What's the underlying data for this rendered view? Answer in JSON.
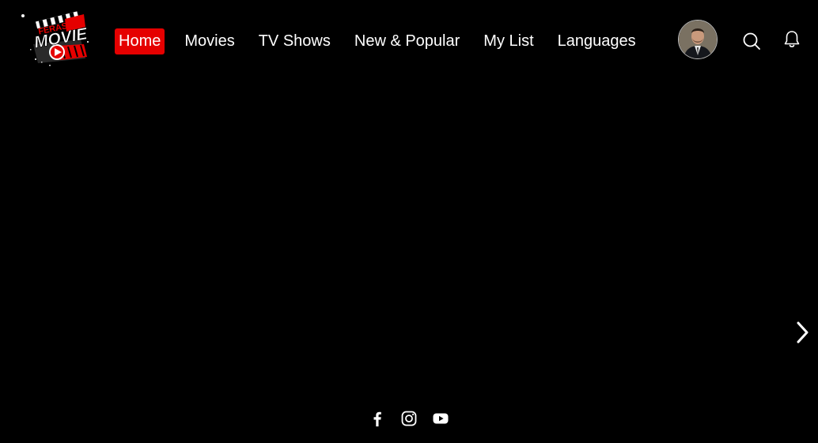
{
  "brand": {
    "logo_top_text": "FERAS",
    "logo_main_text": "MOVIE",
    "accent_color": "#e50000"
  },
  "nav": {
    "items": [
      {
        "label": "Home",
        "active": true
      },
      {
        "label": "Movies",
        "active": false
      },
      {
        "label": "TV Shows",
        "active": false
      },
      {
        "label": "New & Popular",
        "active": false
      },
      {
        "label": "My List",
        "active": false
      },
      {
        "label": "Languages",
        "active": false
      }
    ]
  },
  "header_actions": {
    "avatar_icon": "user-avatar",
    "search_icon": "search-icon",
    "notifications_icon": "bell-icon"
  },
  "hero": {
    "next_icon": "chevron-right-icon"
  },
  "footer": {
    "social": [
      "facebook-icon",
      "instagram-icon",
      "youtube-icon"
    ]
  }
}
